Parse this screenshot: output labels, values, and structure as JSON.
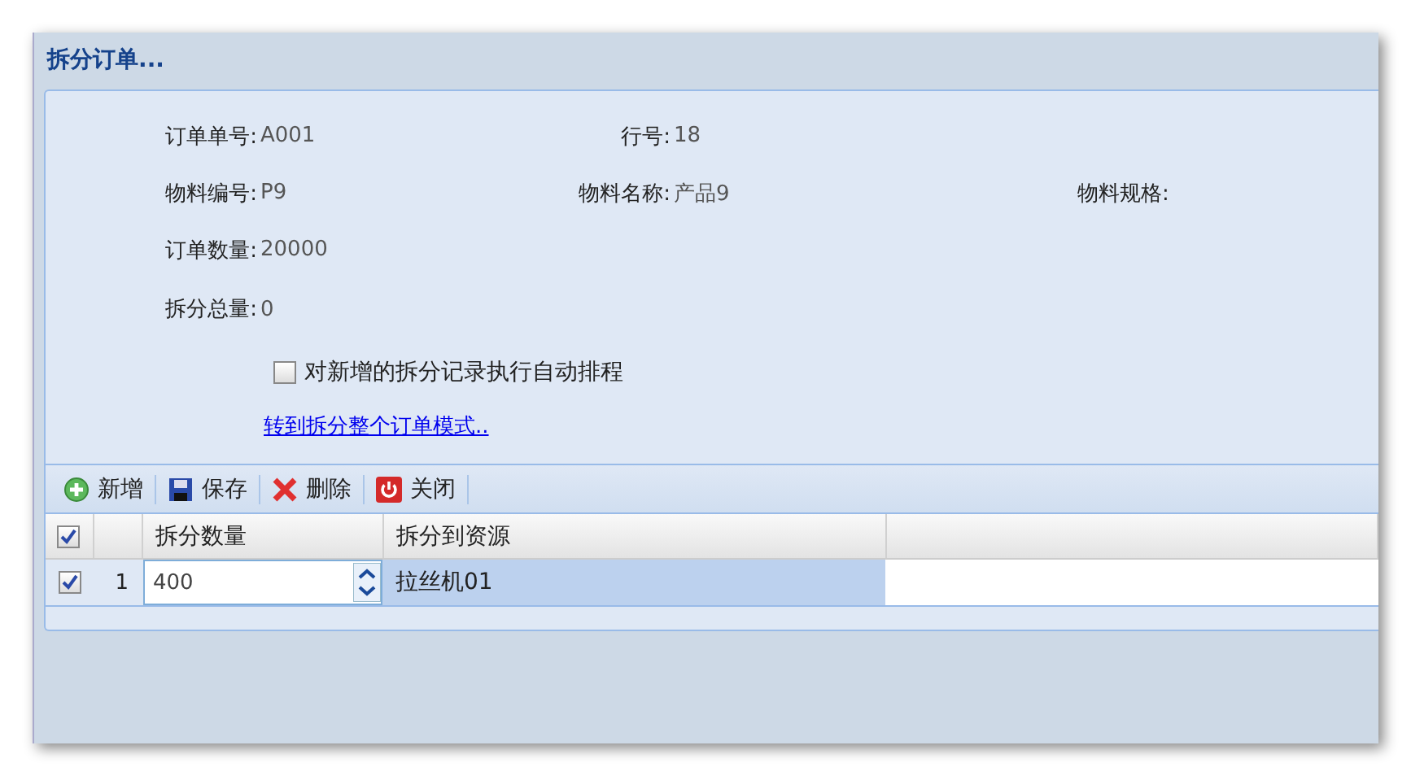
{
  "window": {
    "title": "拆分订单..."
  },
  "form": {
    "rows": [
      [
        {
          "label": "订单单号:",
          "value": "A001"
        },
        {
          "label": "行号:",
          "value": "18"
        }
      ],
      [
        {
          "label": "物料编号:",
          "value": "P9"
        },
        {
          "label": "物料名称:",
          "value": "产品9"
        },
        {
          "label": "物料规格:"
        }
      ],
      [
        {
          "label": "订单数量:",
          "value": "20000"
        }
      ],
      [
        {
          "label": "拆分总量:",
          "value": "0"
        }
      ]
    ],
    "auto_schedule": {
      "label": "对新增的拆分记录执行自动排程",
      "checked": false
    },
    "link": "转到拆分整个订单模式.."
  },
  "toolbar": [
    {
      "kind": "add",
      "label": "新增"
    },
    {
      "kind": "save",
      "label": "保存"
    },
    {
      "kind": "delete",
      "label": "删除"
    },
    {
      "kind": "close",
      "label": "关闭"
    }
  ],
  "table": {
    "header_checked": true,
    "columns": [
      "拆分数量",
      "拆分到资源"
    ],
    "rows": [
      {
        "checked": true,
        "selected": true,
        "number": "1",
        "quantity": "400",
        "resource": "拉丝机01"
      }
    ]
  }
}
